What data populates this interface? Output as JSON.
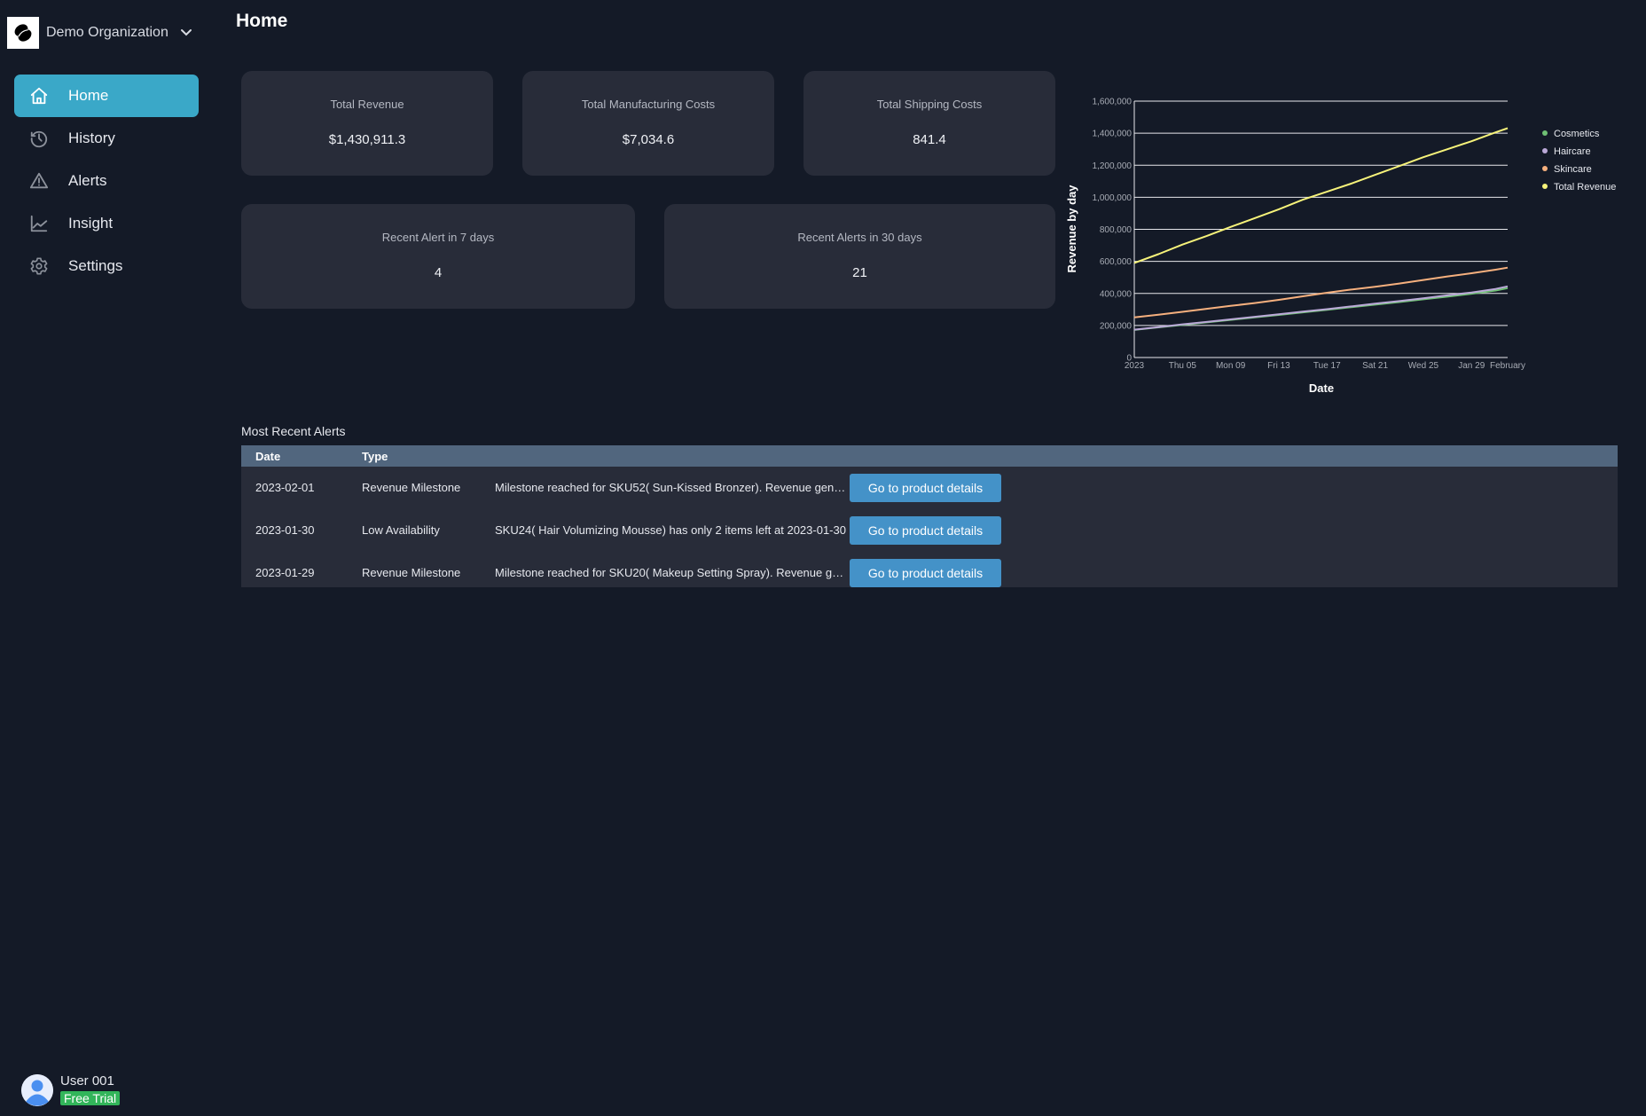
{
  "org": {
    "name": "Demo Organization",
    "logo_icon": "org-logo-icon",
    "dropdown_icon": "chevron-down-icon"
  },
  "page": {
    "title": "Home"
  },
  "sidebar": {
    "items": [
      {
        "label": "Home",
        "icon": "home-icon",
        "active": true
      },
      {
        "label": "History",
        "icon": "history-icon",
        "active": false
      },
      {
        "label": "Alerts",
        "icon": "alert-triangle-icon",
        "active": false
      },
      {
        "label": "Insight",
        "icon": "line-chart-icon",
        "active": false
      },
      {
        "label": "Settings",
        "icon": "gear-icon",
        "active": false
      }
    ]
  },
  "user": {
    "name": "User 001",
    "plan_badge": "Free Trial",
    "avatar_icon": "user-avatar-icon"
  },
  "stats": {
    "total_revenue": {
      "label": "Total Revenue",
      "value": "$1,430,911.3"
    },
    "manufacturing": {
      "label": "Total Manufacturing Costs",
      "value": "$7,034.6"
    },
    "shipping": {
      "label": "Total Shipping Costs",
      "value": "841.4"
    },
    "alerts_7": {
      "label": "Recent Alert in 7 days",
      "value": "4"
    },
    "alerts_30": {
      "label": "Recent Alerts in 30 days",
      "value": "21"
    }
  },
  "alerts_table": {
    "title": "Most Recent Alerts",
    "columns": [
      "Date",
      "Type"
    ],
    "rows": [
      {
        "date": "2023-02-01",
        "type": "Revenue Milestone",
        "message": "Milestone reached for SKU52( Sun-Kissed Bronzer). Revenue generated exceeded milestone",
        "button": "Go to product details"
      },
      {
        "date": "2023-01-30",
        "type": "Low Availability",
        "message": "SKU24( Hair Volumizing Mousse) has only 2 items left at 2023-01-30",
        "button": "Go to product details"
      },
      {
        "date": "2023-01-29",
        "type": "Revenue Milestone",
        "message": "Milestone reached for SKU20( Makeup Setting Spray). Revenue generated exceeded milestone",
        "button": "Go to product details"
      }
    ]
  },
  "colors": {
    "accent": "#3aa8c8",
    "button": "#4492c8",
    "badge": "#32b55a",
    "cosmetics": "#6fc074",
    "haircare": "#bba9d8",
    "skincare": "#f6b07e",
    "total_revenue": "#f7f37a"
  },
  "chart_data": {
    "type": "line",
    "title": "",
    "xlabel": "Date",
    "ylabel": "Revenue by day",
    "ylim": [
      0,
      1600000
    ],
    "yticks": [
      0,
      200000,
      400000,
      600000,
      800000,
      1000000,
      1200000,
      1400000,
      1600000
    ],
    "ytick_labels": [
      "0",
      "200,000",
      "400,000",
      "600,000",
      "800,000",
      "1,000,000",
      "1,200,000",
      "1,400,000",
      "1,600,000"
    ],
    "xlim_days": [
      0,
      31
    ],
    "xticks": [
      {
        "day": 0,
        "label": "2023"
      },
      {
        "day": 4,
        "label": "Thu 05"
      },
      {
        "day": 8,
        "label": "Mon 09"
      },
      {
        "day": 12,
        "label": "Fri 13"
      },
      {
        "day": 16,
        "label": "Tue 17"
      },
      {
        "day": 20,
        "label": "Sat 21"
      },
      {
        "day": 24,
        "label": "Wed 25"
      },
      {
        "day": 28,
        "label": "Jan 29"
      },
      {
        "day": 31,
        "label": "February"
      }
    ],
    "grid": true,
    "legend_position": "right",
    "x": [
      0,
      2,
      4,
      6,
      8,
      10,
      12,
      14,
      16,
      18,
      20,
      22,
      24,
      26,
      28,
      30,
      31
    ],
    "series": [
      {
        "name": "Cosmetics",
        "color": "#6fc074",
        "values": [
          172000,
          188000,
          204000,
          219000,
          235000,
          250000,
          266000,
          282000,
          298000,
          314000,
          330000,
          346000,
          363000,
          380000,
          398000,
          418000,
          433000
        ]
      },
      {
        "name": "Haircare",
        "color": "#bba9d8",
        "values": [
          174000,
          190000,
          207000,
          222000,
          238000,
          254000,
          270000,
          286000,
          302000,
          319000,
          336000,
          352000,
          370000,
          388000,
          406000,
          428000,
          444000
        ]
      },
      {
        "name": "Skincare",
        "color": "#f6b07e",
        "values": [
          250000,
          267000,
          285000,
          304000,
          322000,
          340000,
          360000,
          382000,
          404000,
          424000,
          442000,
          462000,
          484000,
          506000,
          526000,
          548000,
          561000
        ]
      },
      {
        "name": "Total Revenue",
        "color": "#f7f37a",
        "values": [
          590000,
          645000,
          705000,
          758000,
          815000,
          870000,
          925000,
          985000,
          1035000,
          1085000,
          1140000,
          1195000,
          1250000,
          1300000,
          1350000,
          1405000,
          1430911
        ]
      }
    ]
  }
}
